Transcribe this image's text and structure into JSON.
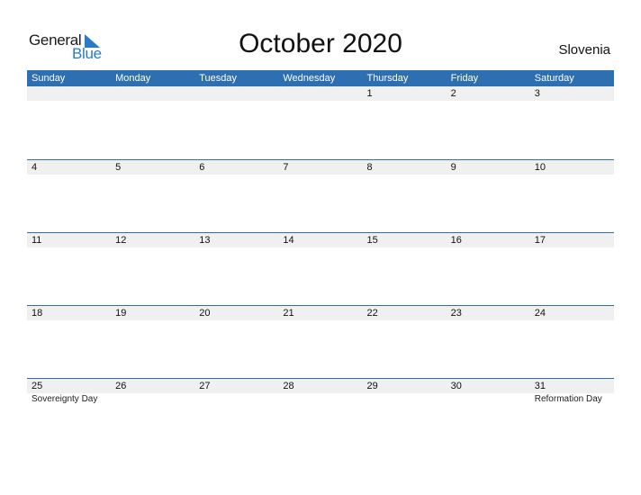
{
  "logo": {
    "general": "General",
    "blue": "Blue"
  },
  "title": "October 2020",
  "country": "Slovenia",
  "weekdays": [
    "Sunday",
    "Monday",
    "Tuesday",
    "Wednesday",
    "Thursday",
    "Friday",
    "Saturday"
  ],
  "weeks": [
    {
      "days": [
        "",
        "",
        "",
        "",
        "1",
        "2",
        "3"
      ],
      "events": [
        "",
        "",
        "",
        "",
        "",
        "",
        ""
      ]
    },
    {
      "days": [
        "4",
        "5",
        "6",
        "7",
        "8",
        "9",
        "10"
      ],
      "events": [
        "",
        "",
        "",
        "",
        "",
        "",
        ""
      ]
    },
    {
      "days": [
        "11",
        "12",
        "13",
        "14",
        "15",
        "16",
        "17"
      ],
      "events": [
        "",
        "",
        "",
        "",
        "",
        "",
        ""
      ]
    },
    {
      "days": [
        "18",
        "19",
        "20",
        "21",
        "22",
        "23",
        "24"
      ],
      "events": [
        "",
        "",
        "",
        "",
        "",
        "",
        ""
      ]
    },
    {
      "days": [
        "25",
        "26",
        "27",
        "28",
        "29",
        "30",
        "31"
      ],
      "events": [
        "Sovereignty Day",
        "",
        "",
        "",
        "",
        "",
        "Reformation Day"
      ]
    }
  ],
  "colors": {
    "header_bg": "#2d6fb1",
    "accent_blue": "#2a7bc6",
    "date_row_bg": "#f0f0f0"
  }
}
